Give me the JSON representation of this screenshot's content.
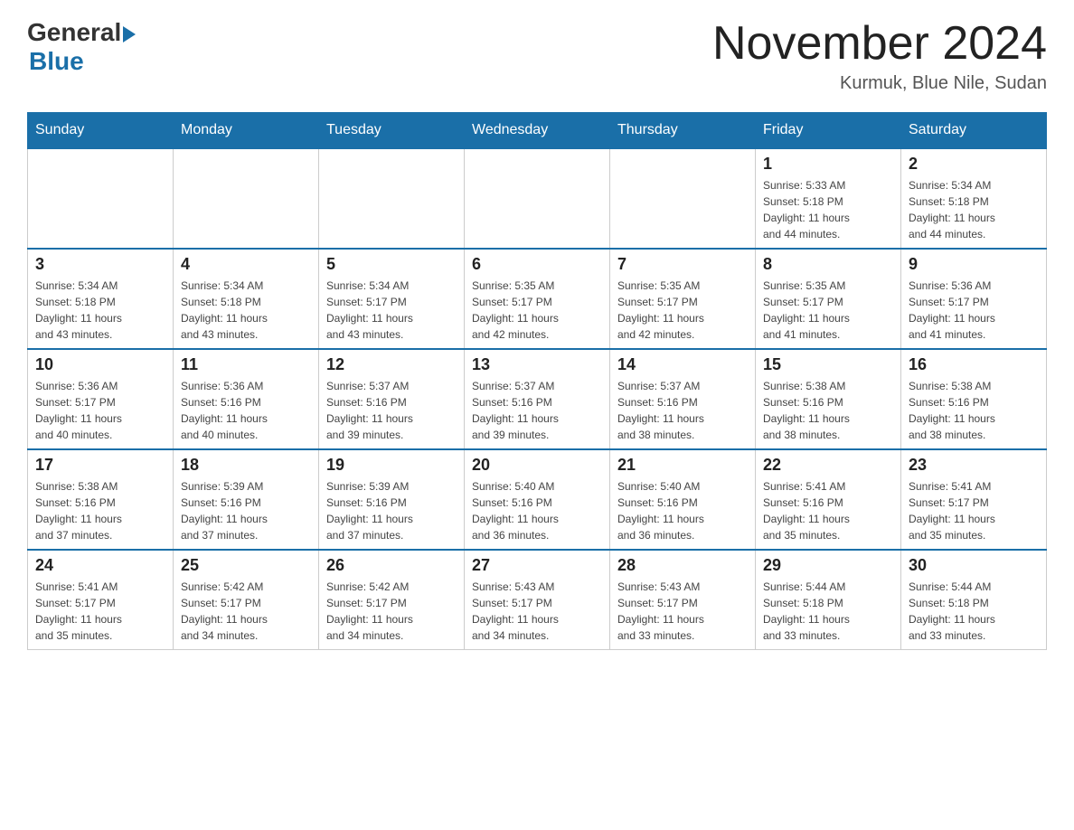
{
  "header": {
    "logo_general": "General",
    "logo_blue": "Blue",
    "month_title": "November 2024",
    "location": "Kurmuk, Blue Nile, Sudan"
  },
  "weekdays": [
    "Sunday",
    "Monday",
    "Tuesday",
    "Wednesday",
    "Thursday",
    "Friday",
    "Saturday"
  ],
  "weeks": [
    [
      {
        "day": "",
        "info": ""
      },
      {
        "day": "",
        "info": ""
      },
      {
        "day": "",
        "info": ""
      },
      {
        "day": "",
        "info": ""
      },
      {
        "day": "",
        "info": ""
      },
      {
        "day": "1",
        "info": "Sunrise: 5:33 AM\nSunset: 5:18 PM\nDaylight: 11 hours\nand 44 minutes."
      },
      {
        "day": "2",
        "info": "Sunrise: 5:34 AM\nSunset: 5:18 PM\nDaylight: 11 hours\nand 44 minutes."
      }
    ],
    [
      {
        "day": "3",
        "info": "Sunrise: 5:34 AM\nSunset: 5:18 PM\nDaylight: 11 hours\nand 43 minutes."
      },
      {
        "day": "4",
        "info": "Sunrise: 5:34 AM\nSunset: 5:18 PM\nDaylight: 11 hours\nand 43 minutes."
      },
      {
        "day": "5",
        "info": "Sunrise: 5:34 AM\nSunset: 5:17 PM\nDaylight: 11 hours\nand 43 minutes."
      },
      {
        "day": "6",
        "info": "Sunrise: 5:35 AM\nSunset: 5:17 PM\nDaylight: 11 hours\nand 42 minutes."
      },
      {
        "day": "7",
        "info": "Sunrise: 5:35 AM\nSunset: 5:17 PM\nDaylight: 11 hours\nand 42 minutes."
      },
      {
        "day": "8",
        "info": "Sunrise: 5:35 AM\nSunset: 5:17 PM\nDaylight: 11 hours\nand 41 minutes."
      },
      {
        "day": "9",
        "info": "Sunrise: 5:36 AM\nSunset: 5:17 PM\nDaylight: 11 hours\nand 41 minutes."
      }
    ],
    [
      {
        "day": "10",
        "info": "Sunrise: 5:36 AM\nSunset: 5:17 PM\nDaylight: 11 hours\nand 40 minutes."
      },
      {
        "day": "11",
        "info": "Sunrise: 5:36 AM\nSunset: 5:16 PM\nDaylight: 11 hours\nand 40 minutes."
      },
      {
        "day": "12",
        "info": "Sunrise: 5:37 AM\nSunset: 5:16 PM\nDaylight: 11 hours\nand 39 minutes."
      },
      {
        "day": "13",
        "info": "Sunrise: 5:37 AM\nSunset: 5:16 PM\nDaylight: 11 hours\nand 39 minutes."
      },
      {
        "day": "14",
        "info": "Sunrise: 5:37 AM\nSunset: 5:16 PM\nDaylight: 11 hours\nand 38 minutes."
      },
      {
        "day": "15",
        "info": "Sunrise: 5:38 AM\nSunset: 5:16 PM\nDaylight: 11 hours\nand 38 minutes."
      },
      {
        "day": "16",
        "info": "Sunrise: 5:38 AM\nSunset: 5:16 PM\nDaylight: 11 hours\nand 38 minutes."
      }
    ],
    [
      {
        "day": "17",
        "info": "Sunrise: 5:38 AM\nSunset: 5:16 PM\nDaylight: 11 hours\nand 37 minutes."
      },
      {
        "day": "18",
        "info": "Sunrise: 5:39 AM\nSunset: 5:16 PM\nDaylight: 11 hours\nand 37 minutes."
      },
      {
        "day": "19",
        "info": "Sunrise: 5:39 AM\nSunset: 5:16 PM\nDaylight: 11 hours\nand 37 minutes."
      },
      {
        "day": "20",
        "info": "Sunrise: 5:40 AM\nSunset: 5:16 PM\nDaylight: 11 hours\nand 36 minutes."
      },
      {
        "day": "21",
        "info": "Sunrise: 5:40 AM\nSunset: 5:16 PM\nDaylight: 11 hours\nand 36 minutes."
      },
      {
        "day": "22",
        "info": "Sunrise: 5:41 AM\nSunset: 5:16 PM\nDaylight: 11 hours\nand 35 minutes."
      },
      {
        "day": "23",
        "info": "Sunrise: 5:41 AM\nSunset: 5:17 PM\nDaylight: 11 hours\nand 35 minutes."
      }
    ],
    [
      {
        "day": "24",
        "info": "Sunrise: 5:41 AM\nSunset: 5:17 PM\nDaylight: 11 hours\nand 35 minutes."
      },
      {
        "day": "25",
        "info": "Sunrise: 5:42 AM\nSunset: 5:17 PM\nDaylight: 11 hours\nand 34 minutes."
      },
      {
        "day": "26",
        "info": "Sunrise: 5:42 AM\nSunset: 5:17 PM\nDaylight: 11 hours\nand 34 minutes."
      },
      {
        "day": "27",
        "info": "Sunrise: 5:43 AM\nSunset: 5:17 PM\nDaylight: 11 hours\nand 34 minutes."
      },
      {
        "day": "28",
        "info": "Sunrise: 5:43 AM\nSunset: 5:17 PM\nDaylight: 11 hours\nand 33 minutes."
      },
      {
        "day": "29",
        "info": "Sunrise: 5:44 AM\nSunset: 5:18 PM\nDaylight: 11 hours\nand 33 minutes."
      },
      {
        "day": "30",
        "info": "Sunrise: 5:44 AM\nSunset: 5:18 PM\nDaylight: 11 hours\nand 33 minutes."
      }
    ]
  ]
}
